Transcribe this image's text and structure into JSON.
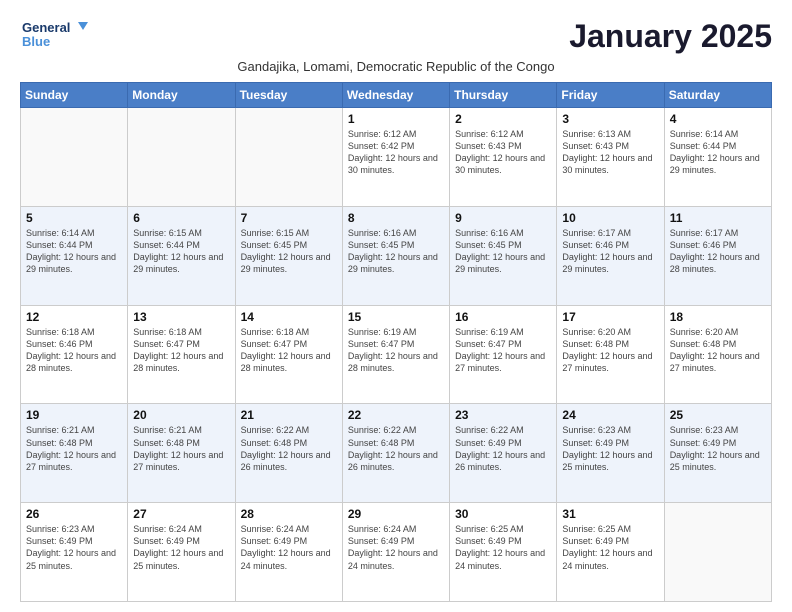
{
  "logo": {
    "line1": "General",
    "line2": "Blue"
  },
  "title": "January 2025",
  "subtitle": "Gandajika, Lomami, Democratic Republic of the Congo",
  "weekdays": [
    "Sunday",
    "Monday",
    "Tuesday",
    "Wednesday",
    "Thursday",
    "Friday",
    "Saturday"
  ],
  "weeks": [
    [
      {
        "day": "",
        "info": ""
      },
      {
        "day": "",
        "info": ""
      },
      {
        "day": "",
        "info": ""
      },
      {
        "day": "1",
        "info": "Sunrise: 6:12 AM\nSunset: 6:42 PM\nDaylight: 12 hours and 30 minutes."
      },
      {
        "day": "2",
        "info": "Sunrise: 6:12 AM\nSunset: 6:43 PM\nDaylight: 12 hours and 30 minutes."
      },
      {
        "day": "3",
        "info": "Sunrise: 6:13 AM\nSunset: 6:43 PM\nDaylight: 12 hours and 30 minutes."
      },
      {
        "day": "4",
        "info": "Sunrise: 6:14 AM\nSunset: 6:44 PM\nDaylight: 12 hours and 29 minutes."
      }
    ],
    [
      {
        "day": "5",
        "info": "Sunrise: 6:14 AM\nSunset: 6:44 PM\nDaylight: 12 hours and 29 minutes."
      },
      {
        "day": "6",
        "info": "Sunrise: 6:15 AM\nSunset: 6:44 PM\nDaylight: 12 hours and 29 minutes."
      },
      {
        "day": "7",
        "info": "Sunrise: 6:15 AM\nSunset: 6:45 PM\nDaylight: 12 hours and 29 minutes."
      },
      {
        "day": "8",
        "info": "Sunrise: 6:16 AM\nSunset: 6:45 PM\nDaylight: 12 hours and 29 minutes."
      },
      {
        "day": "9",
        "info": "Sunrise: 6:16 AM\nSunset: 6:45 PM\nDaylight: 12 hours and 29 minutes."
      },
      {
        "day": "10",
        "info": "Sunrise: 6:17 AM\nSunset: 6:46 PM\nDaylight: 12 hours and 29 minutes."
      },
      {
        "day": "11",
        "info": "Sunrise: 6:17 AM\nSunset: 6:46 PM\nDaylight: 12 hours and 28 minutes."
      }
    ],
    [
      {
        "day": "12",
        "info": "Sunrise: 6:18 AM\nSunset: 6:46 PM\nDaylight: 12 hours and 28 minutes."
      },
      {
        "day": "13",
        "info": "Sunrise: 6:18 AM\nSunset: 6:47 PM\nDaylight: 12 hours and 28 minutes."
      },
      {
        "day": "14",
        "info": "Sunrise: 6:18 AM\nSunset: 6:47 PM\nDaylight: 12 hours and 28 minutes."
      },
      {
        "day": "15",
        "info": "Sunrise: 6:19 AM\nSunset: 6:47 PM\nDaylight: 12 hours and 28 minutes."
      },
      {
        "day": "16",
        "info": "Sunrise: 6:19 AM\nSunset: 6:47 PM\nDaylight: 12 hours and 27 minutes."
      },
      {
        "day": "17",
        "info": "Sunrise: 6:20 AM\nSunset: 6:48 PM\nDaylight: 12 hours and 27 minutes."
      },
      {
        "day": "18",
        "info": "Sunrise: 6:20 AM\nSunset: 6:48 PM\nDaylight: 12 hours and 27 minutes."
      }
    ],
    [
      {
        "day": "19",
        "info": "Sunrise: 6:21 AM\nSunset: 6:48 PM\nDaylight: 12 hours and 27 minutes."
      },
      {
        "day": "20",
        "info": "Sunrise: 6:21 AM\nSunset: 6:48 PM\nDaylight: 12 hours and 27 minutes."
      },
      {
        "day": "21",
        "info": "Sunrise: 6:22 AM\nSunset: 6:48 PM\nDaylight: 12 hours and 26 minutes."
      },
      {
        "day": "22",
        "info": "Sunrise: 6:22 AM\nSunset: 6:48 PM\nDaylight: 12 hours and 26 minutes."
      },
      {
        "day": "23",
        "info": "Sunrise: 6:22 AM\nSunset: 6:49 PM\nDaylight: 12 hours and 26 minutes."
      },
      {
        "day": "24",
        "info": "Sunrise: 6:23 AM\nSunset: 6:49 PM\nDaylight: 12 hours and 25 minutes."
      },
      {
        "day": "25",
        "info": "Sunrise: 6:23 AM\nSunset: 6:49 PM\nDaylight: 12 hours and 25 minutes."
      }
    ],
    [
      {
        "day": "26",
        "info": "Sunrise: 6:23 AM\nSunset: 6:49 PM\nDaylight: 12 hours and 25 minutes."
      },
      {
        "day": "27",
        "info": "Sunrise: 6:24 AM\nSunset: 6:49 PM\nDaylight: 12 hours and 25 minutes."
      },
      {
        "day": "28",
        "info": "Sunrise: 6:24 AM\nSunset: 6:49 PM\nDaylight: 12 hours and 24 minutes."
      },
      {
        "day": "29",
        "info": "Sunrise: 6:24 AM\nSunset: 6:49 PM\nDaylight: 12 hours and 24 minutes."
      },
      {
        "day": "30",
        "info": "Sunrise: 6:25 AM\nSunset: 6:49 PM\nDaylight: 12 hours and 24 minutes."
      },
      {
        "day": "31",
        "info": "Sunrise: 6:25 AM\nSunset: 6:49 PM\nDaylight: 12 hours and 24 minutes."
      },
      {
        "day": "",
        "info": ""
      }
    ]
  ]
}
